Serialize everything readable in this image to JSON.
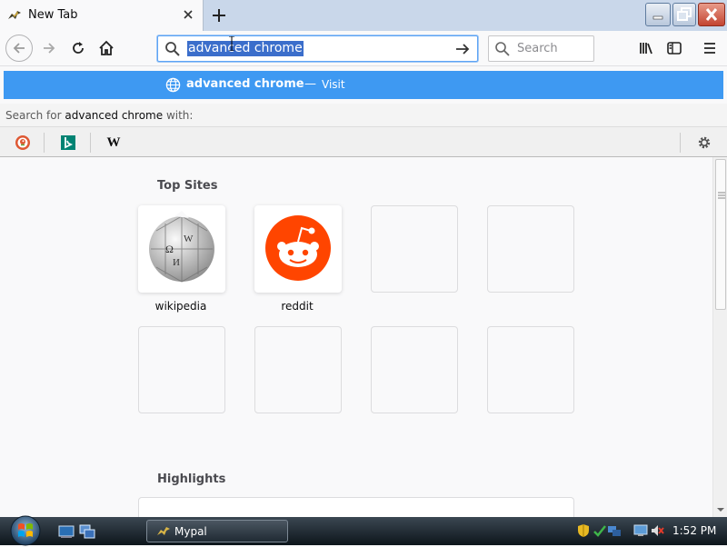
{
  "browser": {
    "tab": {
      "title": "New Tab"
    },
    "url_bar": {
      "value": "advanced chrome"
    },
    "search_box": {
      "placeholder": "Search"
    }
  },
  "suggestion": {
    "title": "advanced chrome",
    "separator": "—",
    "action": "Visit"
  },
  "search_with": {
    "lead": "Search for",
    "term": "advanced chrome",
    "tail": "with:"
  },
  "engines": [
    {
      "name": "duckduckgo-icon"
    },
    {
      "name": "bing-icon"
    },
    {
      "name": "wikipedia-icon",
      "glyph": "W"
    }
  ],
  "newtab": {
    "top_sites": {
      "title": "Top Sites",
      "sites": [
        {
          "label": "wikipedia"
        },
        {
          "label": "reddit"
        }
      ]
    },
    "highlights": {
      "title": "Highlights"
    }
  },
  "taskbar": {
    "app_label": "Mypal",
    "clock": "1:52 PM"
  },
  "colors": {
    "accent": "#3e99f2",
    "reddit": "#ff4500",
    "bing": "#008373",
    "selection": "#3b6ecb"
  }
}
